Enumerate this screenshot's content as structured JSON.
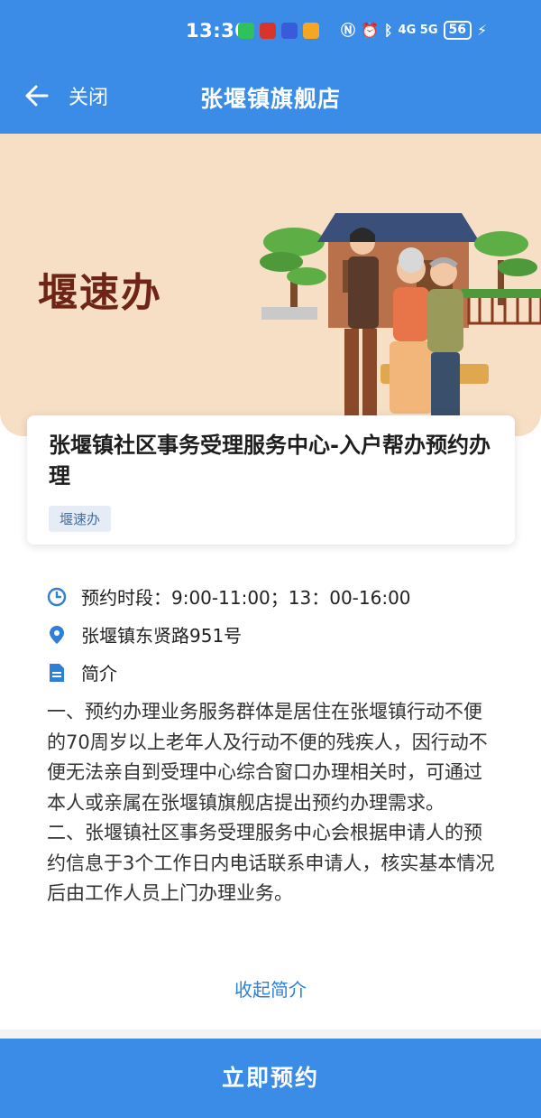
{
  "status_bar": {
    "time": "13:30",
    "network": "4G 5G",
    "battery": "56"
  },
  "nav": {
    "close_label": "关闭",
    "title": "张堰镇旗舰店"
  },
  "hero": {
    "brand_text": "堰速办"
  },
  "service": {
    "title": "张堰镇社区事务受理服务中心-入户帮办预约办理",
    "tag": "堰速办"
  },
  "details": {
    "time_slot": "预约时段：9:00-11:00；13：00-16:00",
    "address": "张堰镇东贤路951号",
    "intro_label": "简介",
    "intro_text": "一、预约办理业务服务群体是居住在张堰镇行动不便的70周岁以上老年人及行动不便的残疾人，因行动不便无法亲自到受理中心综合窗口办理相关时，可通过本人或亲属在张堰镇旗舰店提出预约办理需求。\n二、张堰镇社区事务受理服务中心会根据申请人的预约信息于3个工作日内电话联系申请人，核实基本情况后由工作人员上门办理业务。",
    "collapse_label": "收起简介"
  },
  "actions": {
    "book_label": "立即预约"
  },
  "colors": {
    "primary": "#3b8ce6",
    "hero_bg": "#f7dfc5",
    "brand_text": "#6e2516",
    "link": "#2d7fd8",
    "tag_bg": "#e5ecf6"
  }
}
